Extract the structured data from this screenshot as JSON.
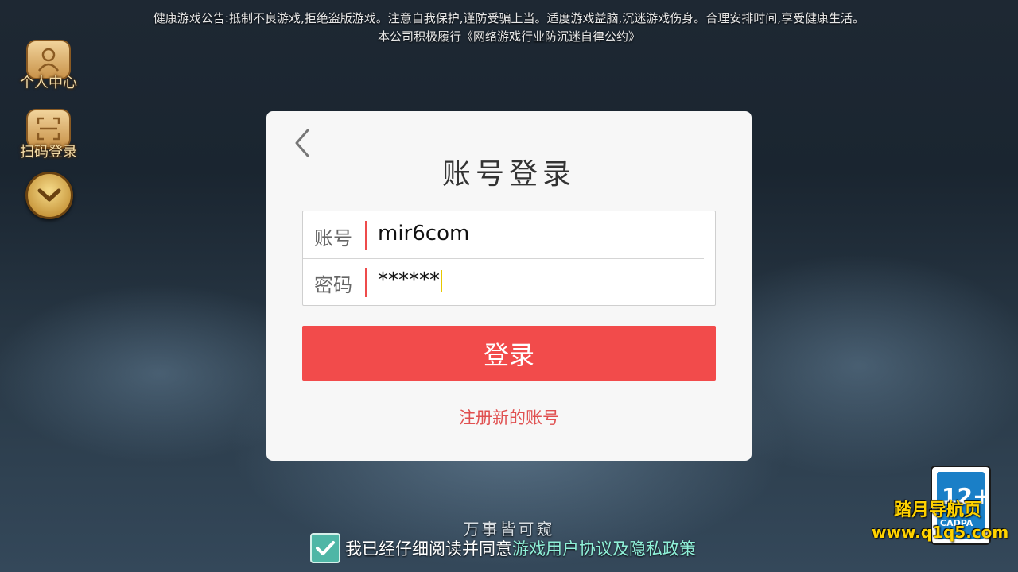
{
  "notice": {
    "line1": "健康游戏公告:抵制不良游戏,拒绝盗版游戏。注意自我保护,谨防受骗上当。适度游戏益脑,沉迷游戏伤身。合理安排时间,享受健康生活。",
    "line2": "本公司积极履行《网络游戏行业防沉迷自律公约》"
  },
  "sidebar": {
    "profile_label": "个人中心",
    "scan_label": "扫码登录"
  },
  "login": {
    "title": "账号登录",
    "account_label": "账号",
    "account_value": "mir6com",
    "password_label": "密码",
    "password_value": "******",
    "submit_label": "登录",
    "register_label": "注册新的账号"
  },
  "footer": {
    "slogan": "万事皆可窥",
    "agree_text": "我已经仔细阅读并同意",
    "agree_link": "游戏用户协议及隐私政策",
    "agree_checked": true
  },
  "badge": {
    "age": "12+",
    "org": "CADPA"
  },
  "watermark": {
    "line1": "踏月导航页",
    "line2": "www.q1q5.com"
  },
  "colors": {
    "accent": "#f24b4b",
    "link": "#e05050",
    "gold": "#d9a446"
  }
}
